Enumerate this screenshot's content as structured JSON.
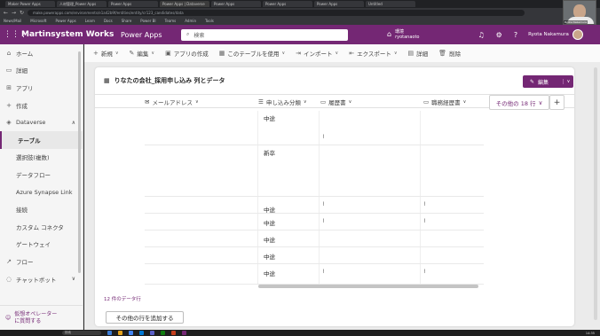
{
  "browser": {
    "tabs": [
      "Maker Power Apps",
      "人材管理_Power Apps",
      "Power Apps",
      "Power Apps | Dataverse",
      "Power Apps",
      "Power Apps",
      "Power Apps",
      "Untitled"
    ],
    "url": "make.powerapps.com/environments/e1a42b9f/entities/entity/cr123_candidates/data",
    "bookmarks": [
      "News/Mail",
      "Microsoft",
      "Power Apps",
      "Learn",
      "Docs",
      "Share",
      "Power BI",
      "Teams",
      "Admin",
      "Tools"
    ],
    "webcam_label": "Ryota Nakamura"
  },
  "appbar": {
    "env_name": "Martinsystem Works",
    "app_name": "Power Apps",
    "search_placeholder": "検索",
    "environment_label": "環境",
    "environment_value": "ryotanaoto",
    "user_name": "Ryota Nakamura"
  },
  "sidebar": {
    "items": [
      {
        "label": "ホーム",
        "icon": "home-icon",
        "glyph": "⌂"
      },
      {
        "label": "詳細",
        "icon": "details-icon",
        "glyph": "▭"
      },
      {
        "label": "アプリ",
        "icon": "apps-icon",
        "glyph": "⊞"
      },
      {
        "label": "作成",
        "icon": "create-icon",
        "glyph": "+"
      },
      {
        "label": "Dataverse",
        "icon": "database-icon",
        "glyph": "◈"
      },
      {
        "label": "テーブル",
        "icon": "",
        "glyph": ""
      },
      {
        "label": "選択肢(複数)",
        "icon": "",
        "glyph": ""
      },
      {
        "label": "データフロー",
        "icon": "",
        "glyph": ""
      },
      {
        "label": "Azure Synapse Link",
        "icon": "",
        "glyph": ""
      },
      {
        "label": "接続",
        "icon": "",
        "glyph": ""
      },
      {
        "label": "カスタム コネクタ",
        "icon": "",
        "glyph": ""
      },
      {
        "label": "ゲートウェイ",
        "icon": "",
        "glyph": ""
      },
      {
        "label": "フロー",
        "icon": "flow-icon",
        "glyph": "↗"
      },
      {
        "label": "チャットボット",
        "icon": "chatbot-icon",
        "glyph": "◌"
      }
    ],
    "footer_line1": "仮想オペレーター",
    "footer_line2": "に質問する"
  },
  "commandbar": {
    "new": "新規",
    "edit": "編集",
    "create_app": "アプリの作成",
    "use_table": "このテーブルを使用",
    "import": "インポート",
    "export": "エクスポート",
    "detail": "詳細",
    "delete": "削除"
  },
  "card": {
    "title": "りなたの会社_採用申し込み 列とデータ",
    "edit_label": "編集",
    "columns": [
      {
        "label": "メールアドレス",
        "icon": "email-icon"
      },
      {
        "label": "申し込み分類",
        "icon": "choice-icon"
      },
      {
        "label": "履歴書",
        "icon": "file-icon"
      },
      {
        "label": "職務経歴書",
        "icon": "file-icon"
      }
    ],
    "more_columns": "その他の 18 行",
    "row_count": "12 件のデータ行",
    "add_rows_label": "その他の行を追加する"
  },
  "rows": [
    {
      "category": "中途",
      "resume": true,
      "career": false
    },
    {
      "category": "新卒",
      "resume": false,
      "career": false
    },
    {
      "category": "中途",
      "resume": true,
      "career": true
    },
    {
      "category": "中途",
      "resume": true,
      "career": true
    },
    {
      "category": "中途",
      "resume": false,
      "career": false
    },
    {
      "category": "中途",
      "resume": false,
      "career": false
    },
    {
      "category": "中途",
      "resume": true,
      "career": true
    }
  ],
  "taskbar": {
    "search": "検索",
    "time": "14:35"
  },
  "colors": {
    "brand": "#742774"
  }
}
